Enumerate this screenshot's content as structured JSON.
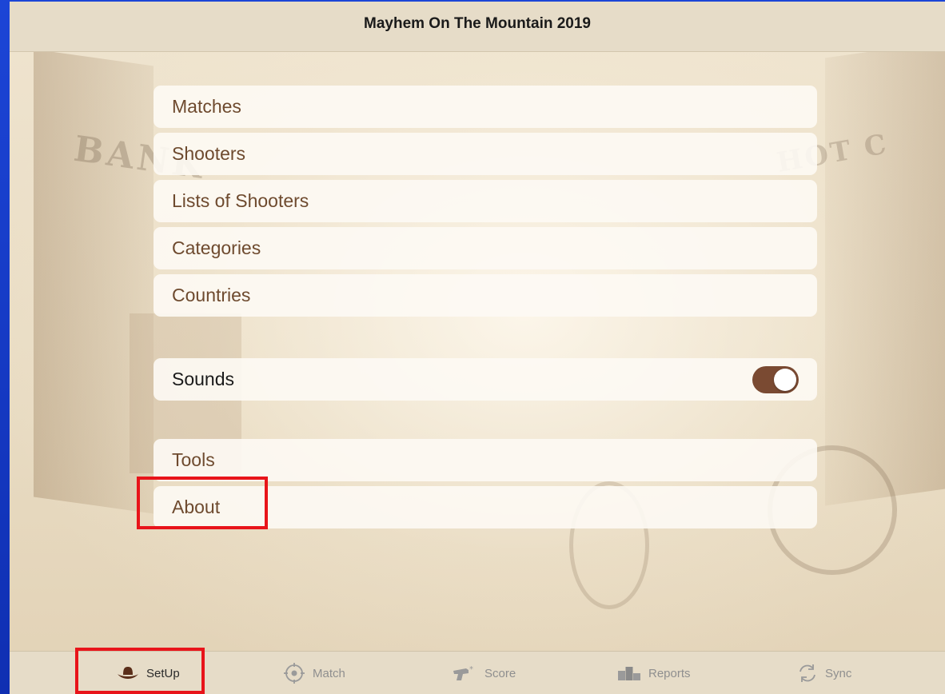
{
  "nav": {
    "title": "Mayhem On The Mountain 2019"
  },
  "background": {
    "sign_left": "BANK",
    "sign_right": "HOT C"
  },
  "menu": {
    "main": [
      {
        "label": "Matches"
      },
      {
        "label": "Shooters"
      },
      {
        "label": "Lists of Shooters"
      },
      {
        "label": "Categories"
      },
      {
        "label": "Countries"
      }
    ],
    "sounds": {
      "label": "Sounds",
      "enabled": true
    },
    "tools": [
      {
        "label": "Tools"
      },
      {
        "label": "About"
      }
    ]
  },
  "tabs": [
    {
      "label": "SetUp",
      "icon": "cowboy-hat-icon",
      "active": true
    },
    {
      "label": "Match",
      "icon": "target-icon",
      "active": false
    },
    {
      "label": "Score",
      "icon": "revolver-icon",
      "active": false
    },
    {
      "label": "Reports",
      "icon": "podium-icon",
      "active": false
    },
    {
      "label": "Sync",
      "icon": "sync-icon",
      "active": false
    }
  ],
  "colors": {
    "frame": "#1238c8",
    "accent_brown": "#7a4a32",
    "label_brown": "#6e4a2e",
    "highlight_red": "#e8141a"
  }
}
